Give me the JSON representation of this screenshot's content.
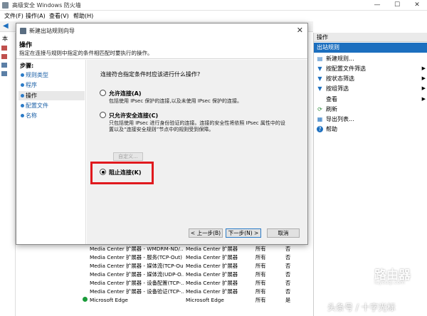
{
  "main_window": {
    "title": "高级安全 Windows 防火墙",
    "controls": {
      "minimize": "—",
      "maximize": "☐",
      "close": "✕"
    },
    "menu": [
      "文件(F)",
      "操作(A)",
      "查看(V)",
      "帮助(H)"
    ],
    "tree_labels": [
      "本",
      "入",
      "出",
      "连",
      "监"
    ]
  },
  "dialog": {
    "title": "新建出站规则向导",
    "close": "✕",
    "header_title": "操作",
    "header_desc": "指定在连接与规则中指定的条件相匹配时要执行的操作。",
    "steps_title": "步骤:",
    "steps": [
      {
        "label": "规则类型"
      },
      {
        "label": "程序"
      },
      {
        "label": "操作"
      },
      {
        "label": "配置文件"
      },
      {
        "label": "名称"
      }
    ],
    "question": "连接符合指定条件时应该进行什么操作?",
    "options": [
      {
        "label": "允许连接(A)",
        "desc": "包括使用 IPsec 保护的连接,以及未使用 IPsec 保护的连接。",
        "selected": false
      },
      {
        "label": "只允许安全连接(C)",
        "desc_line1": "只包括使用 IPsec 进行身份验证的连接。连接的安全性将依照 IPsec 属性中的设",
        "desc_line2": "置以及“连接安全规则”节点中的规则受到保障。",
        "selected": false
      },
      {
        "label": "阻止连接(K)",
        "selected": true
      }
    ],
    "custom_button": "自定义...",
    "buttons": {
      "back": "< 上一步(B)",
      "next": "下一步(N) >",
      "cancel": "取消"
    }
  },
  "rules": [
    {
      "name": "Media Center 扩展器 - WMDRM-ND/...",
      "group": "Media Center 扩展器",
      "profile": "所有",
      "enabled": "否"
    },
    {
      "name": "Media Center 扩展器 - 服务(TCP-Out)",
      "group": "Media Center 扩展器",
      "profile": "所有",
      "enabled": "否"
    },
    {
      "name": "Media Center 扩展器 - 媒体流(TCP-Out)",
      "group": "Media Center 扩展器",
      "profile": "所有",
      "enabled": "否"
    },
    {
      "name": "Media Center 扩展器 - 媒体流(UDP-O...",
      "group": "Media Center 扩展器",
      "profile": "所有",
      "enabled": "否"
    },
    {
      "name": "Media Center 扩展器 - 设备配置(TCP-...",
      "group": "Media Center 扩展器",
      "profile": "所有",
      "enabled": "否"
    },
    {
      "name": "Media Center 扩展器 - 设备验证(TCP-...",
      "group": "Media Center 扩展器",
      "profile": "所有",
      "enabled": "否"
    },
    {
      "name": "Microsoft Edge",
      "group": "Microsoft Edge",
      "profile": "所有",
      "enabled": "是"
    }
  ],
  "actions": {
    "header": "操作",
    "section": "出站规则",
    "items": [
      {
        "label": "新建规则...",
        "icon": "new-rule-icon",
        "glyph": "▤",
        "submenu": false
      },
      {
        "label": "按配置文件筛选",
        "icon": "filter-icon",
        "glyph": "▼",
        "submenu": true
      },
      {
        "label": "按状态筛选",
        "icon": "filter-icon",
        "glyph": "▼",
        "submenu": true
      },
      {
        "label": "按组筛选",
        "icon": "filter-icon",
        "glyph": "▼",
        "submenu": true
      },
      {
        "label": "查看",
        "icon": "view-icon",
        "glyph": "",
        "submenu": true
      },
      {
        "label": "刷新",
        "icon": "refresh-icon",
        "glyph": "⟳",
        "submenu": false
      },
      {
        "label": "导出列表...",
        "icon": "export-icon",
        "glyph": "▦",
        "submenu": false
      },
      {
        "label": "帮助",
        "icon": "help-icon",
        "glyph": "?",
        "submenu": false
      }
    ]
  },
  "watermark": {
    "logo_text": "路由器",
    "logo_domain": "luyouqi.com",
    "bottom_text": "头条号 / 十字光标"
  },
  "colors": {
    "accent": "#1c6fbf",
    "highlight_box": "#e0191e",
    "enabled_icon": "#1a9b3a"
  }
}
